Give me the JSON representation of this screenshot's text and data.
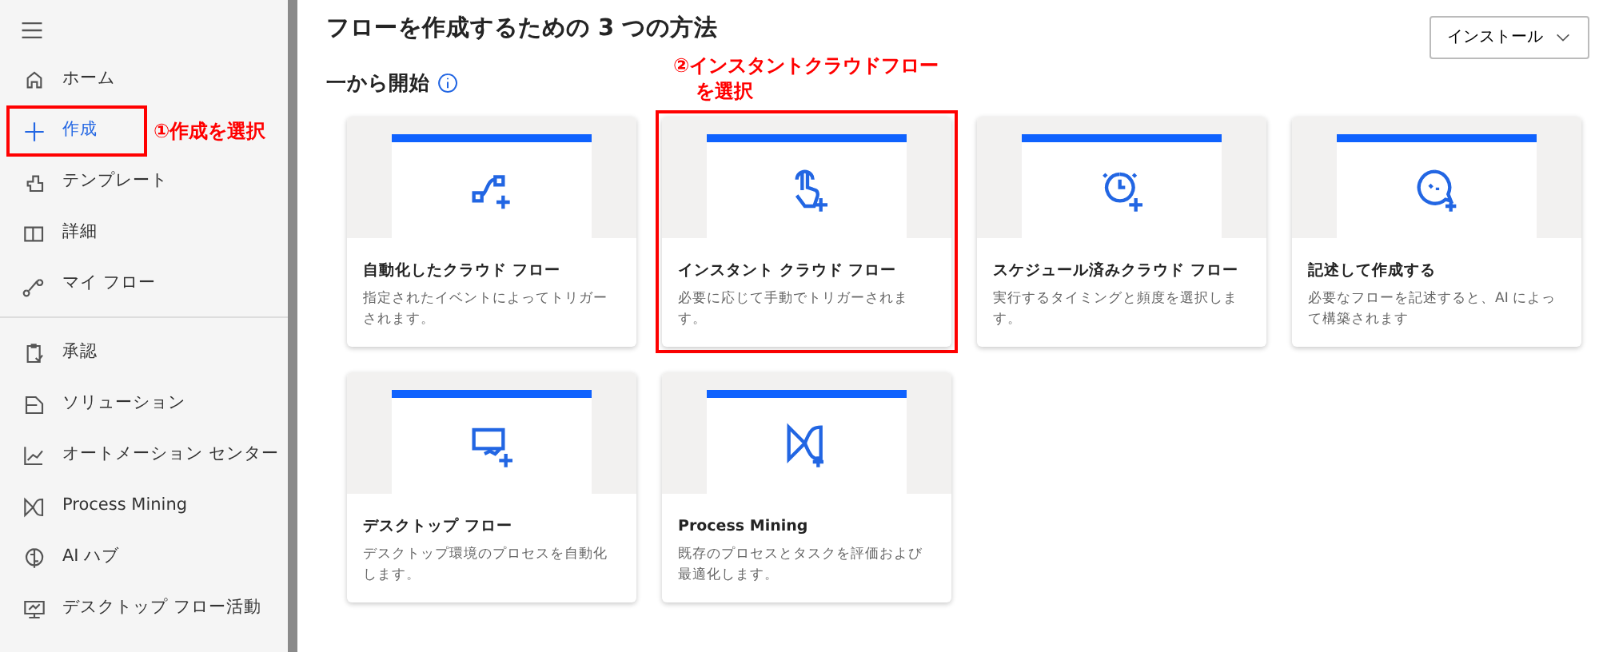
{
  "sidebar": {
    "sections": [
      {
        "items": [
          {
            "label": "ホーム",
            "selected": false,
            "highlighted": false
          },
          {
            "label": "作成",
            "selected": true,
            "highlighted": true
          },
          {
            "label": "テンプレート",
            "selected": false,
            "highlighted": false
          },
          {
            "label": "詳細",
            "selected": false,
            "highlighted": false
          },
          {
            "label": "マイ フロー",
            "selected": false,
            "highlighted": false
          }
        ]
      },
      {
        "items": [
          {
            "label": "承認",
            "selected": false,
            "highlighted": false
          },
          {
            "label": "ソリューション",
            "selected": false,
            "highlighted": false
          },
          {
            "label": "オートメーション センター",
            "selected": false,
            "highlighted": false
          },
          {
            "label": "Process Mining",
            "selected": false,
            "highlighted": false
          },
          {
            "label": "AI ハブ",
            "selected": false,
            "highlighted": false
          },
          {
            "label": "デスクトップ フロー活動",
            "selected": false,
            "highlighted": false
          }
        ]
      }
    ],
    "annotation": "①作成を選択"
  },
  "title": "フローを作成するための 3 つの方法",
  "install_button": "インストール",
  "section": "一から開始",
  "cards_annotation": [
    "②インスタントクラウドフロー",
    "を選択"
  ],
  "cards": [
    {
      "title": "自動化したクラウド フロー",
      "description": "指定されたイベントによってトリガーされます。",
      "highlighted": false
    },
    {
      "title": "インスタント クラウド フロー",
      "description": "必要に応じて手動でトリガーされます。",
      "highlighted": true
    },
    {
      "title": "スケジュール済みクラウド フロー",
      "description": "実行するタイミングと頻度を選択します。",
      "highlighted": false
    },
    {
      "title": "記述して作成する",
      "description": "必要なフローを記述すると、AI によって構築されます",
      "highlighted": false
    },
    {
      "title": "デスクトップ フロー",
      "description": "デスクトップ環境のプロセスを自動化します。",
      "highlighted": false
    },
    {
      "title": "Process Mining",
      "description": "既存のプロセスとタスクを評価および最適化します。",
      "highlighted": false
    }
  ]
}
